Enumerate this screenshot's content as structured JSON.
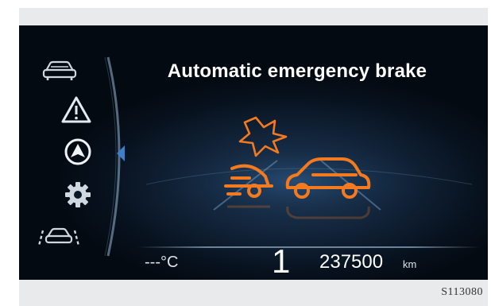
{
  "screen": {
    "title": "Automatic emergency brake",
    "temperature": "---°C",
    "gear": "1",
    "odometer": "237500",
    "odometer_unit": "km"
  },
  "sidebar": {
    "icons": [
      "car-front-icon",
      "warning-triangle-icon",
      "navigation-arrow-icon",
      "settings-gear-icon",
      "lane-assist-car-icon"
    ],
    "selected_index": 2
  },
  "alert": {
    "icon": "forward-collision-icon",
    "color": "#f47a1f"
  },
  "figure": {
    "reference": "S113080"
  },
  "colors": {
    "background": "#07111d",
    "text": "#ffffff",
    "accent_alert": "#f47a1f",
    "selector": "#3f7fc7"
  }
}
